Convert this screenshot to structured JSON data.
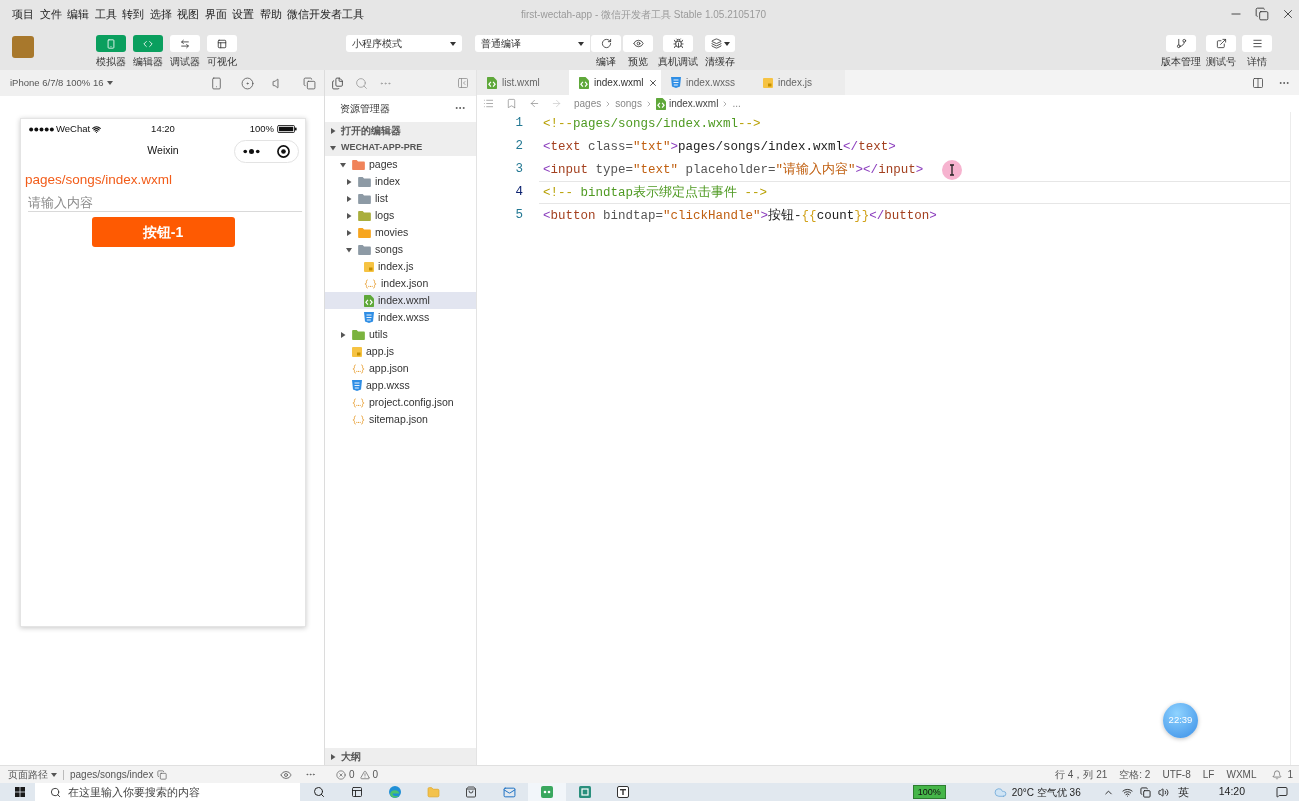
{
  "window": {
    "title": "first-wectah-app - 微信开发者工具 Stable 1.05.2105170"
  },
  "menu": [
    "项目",
    "文件",
    "编辑",
    "工具",
    "转到",
    "选择",
    "视图",
    "界面",
    "设置",
    "帮助",
    "微信开发者工具"
  ],
  "toolbar": {
    "view_toggles": [
      {
        "label": "模拟器",
        "kind": "simulator",
        "on": true
      },
      {
        "label": "编辑器",
        "kind": "editor",
        "on": true
      },
      {
        "label": "调试器",
        "kind": "debugger",
        "on": false
      },
      {
        "label": "可视化",
        "kind": "visual",
        "on": false
      }
    ],
    "mode_select": {
      "value": "小程序模式"
    },
    "compile_select": {
      "value": "普通编译"
    },
    "actions": [
      {
        "label": "编译",
        "kind": "compile"
      },
      {
        "label": "预览",
        "kind": "preview"
      },
      {
        "label": "真机调试",
        "kind": "remote_debug"
      },
      {
        "label": "清缓存",
        "kind": "clear_cache"
      }
    ],
    "right_actions": [
      {
        "label": "版本管理",
        "kind": "version"
      },
      {
        "label": "测试号",
        "kind": "test_account"
      },
      {
        "label": "详情",
        "kind": "details"
      }
    ]
  },
  "simulator": {
    "device": "iPhone 6/7/8 100% 16",
    "status_bar": {
      "carrier": "WeChat",
      "time": "14:20",
      "battery": "100%"
    },
    "nav_title": "Weixin",
    "page_text": "pages/songs/index.wxml",
    "input": {
      "placeholder": "请输入内容"
    },
    "button": "按钮-1"
  },
  "explorer": {
    "title": "资源管理器",
    "open_editors": {
      "label": "打开的编辑器",
      "expanded": false
    },
    "project": {
      "label": "WECHAT-APP-PRE",
      "expanded": true,
      "tree": [
        {
          "name": "pages",
          "kind": "folder",
          "color": "#f0835a",
          "expanded": true,
          "selected": false,
          "children": [
            {
              "name": "index",
              "kind": "folder",
              "color": "#8d9aa5",
              "expanded": false,
              "selected": false
            },
            {
              "name": "list",
              "kind": "folder",
              "color": "#8d9aa5",
              "expanded": false,
              "selected": false
            },
            {
              "name": "logs",
              "kind": "folder",
              "color": "#a9ae3c",
              "expanded": false,
              "selected": false
            },
            {
              "name": "movies",
              "kind": "folder",
              "color": "#f7a51e",
              "expanded": false,
              "selected": false
            },
            {
              "name": "songs",
              "kind": "folder",
              "color": "#8d9aa5",
              "expanded": true,
              "selected": false,
              "children": [
                {
                  "name": "index.js",
                  "kind": "js",
                  "selected": false
                },
                {
                  "name": "index.json",
                  "kind": "json",
                  "selected": false
                },
                {
                  "name": "index.wxml",
                  "kind": "wxml",
                  "selected": true
                },
                {
                  "name": "index.wxss",
                  "kind": "wxss",
                  "selected": false
                }
              ]
            }
          ]
        },
        {
          "name": "utils",
          "kind": "folder",
          "color": "#7bb33f",
          "expanded": false,
          "selected": false
        },
        {
          "name": "app.js",
          "kind": "js",
          "selected": false
        },
        {
          "name": "app.json",
          "kind": "json",
          "selected": false
        },
        {
          "name": "app.wxss",
          "kind": "wxss",
          "selected": false
        },
        {
          "name": "project.config.json",
          "kind": "json",
          "selected": false
        },
        {
          "name": "sitemap.json",
          "kind": "json",
          "selected": false
        }
      ]
    },
    "outline": {
      "label": "大纲",
      "expanded": false
    }
  },
  "editor": {
    "tabs": [
      {
        "label": "list.wxml",
        "kind": "wxml",
        "selected": false
      },
      {
        "label": "index.wxml",
        "kind": "wxml",
        "selected": true
      },
      {
        "label": "index.wxss",
        "kind": "wxss",
        "selected": false
      },
      {
        "label": "index.js",
        "kind": "js",
        "selected": false
      }
    ],
    "breadcrumb": [
      {
        "label": "pages",
        "kind": "folder"
      },
      {
        "label": "songs",
        "kind": "folder"
      },
      {
        "label": "index.wxml",
        "kind": "wxml"
      },
      {
        "label": "...",
        "kind": "more"
      }
    ],
    "lines": [
      {
        "number": "1",
        "current": false,
        "tokens": [
          {
            "kind": "comment_mark",
            "text": "<!--"
          },
          {
            "kind": "comment",
            "text": "pages/songs/index.wxml"
          },
          {
            "kind": "comment_mark",
            "text": "-->"
          }
        ]
      },
      {
        "number": "2",
        "current": false,
        "tokens": [
          {
            "kind": "bracket",
            "text": "<"
          },
          {
            "kind": "tag",
            "text": "text"
          },
          {
            "kind": "attr",
            "text": " class="
          },
          {
            "kind": "string",
            "text": "\"txt\""
          },
          {
            "kind": "bracket",
            "text": ">"
          },
          {
            "kind": "text",
            "text": "pages/songs/index.wxml"
          },
          {
            "kind": "bracket",
            "text": "</"
          },
          {
            "kind": "tag",
            "text": "text"
          },
          {
            "kind": "bracket",
            "text": ">"
          }
        ]
      },
      {
        "number": "3",
        "current": false,
        "tokens": [
          {
            "kind": "bracket",
            "text": "<"
          },
          {
            "kind": "tag",
            "text": "input"
          },
          {
            "kind": "attr",
            "text": " type="
          },
          {
            "kind": "string",
            "text": "\"text\""
          },
          {
            "kind": "attr",
            "text": " placeholder="
          },
          {
            "kind": "string",
            "text": "\"请输入内容\""
          },
          {
            "kind": "bracket",
            "text": "></"
          },
          {
            "kind": "tag",
            "text": "input"
          },
          {
            "kind": "bracket",
            "text": ">"
          }
        ]
      },
      {
        "number": "4",
        "current": true,
        "tokens": [
          {
            "kind": "comment_mark",
            "text": "<!--"
          },
          {
            "kind": "comment",
            "text": " bindtap表示绑定点击事件 "
          },
          {
            "kind": "comment_mark",
            "text": "-->"
          }
        ]
      },
      {
        "number": "5",
        "current": false,
        "tokens": [
          {
            "kind": "bracket",
            "text": "<"
          },
          {
            "kind": "tag",
            "text": "button"
          },
          {
            "kind": "attr",
            "text": " bindtap="
          },
          {
            "kind": "string",
            "text": "\"clickHandle\""
          },
          {
            "kind": "bracket",
            "text": ">"
          },
          {
            "kind": "text",
            "text": "按钮-"
          },
          {
            "kind": "brace",
            "text": "{{"
          },
          {
            "kind": "text",
            "text": "count"
          },
          {
            "kind": "brace",
            "text": "}}"
          },
          {
            "kind": "bracket",
            "text": "</"
          },
          {
            "kind": "tag",
            "text": "button"
          },
          {
            "kind": "bracket",
            "text": ">"
          }
        ]
      }
    ],
    "floating_timer": "22:39"
  },
  "status_bar": {
    "page_path_label": "页面路径",
    "page_path": "pages/songs/index",
    "errors": "0",
    "warnings": "0",
    "position": "行 4，列 21",
    "indent": "空格: 2",
    "encoding": "UTF-8",
    "eol": "LF",
    "language": "WXML",
    "notifications": "1"
  },
  "taskbar": {
    "search": {
      "placeholder": "在这里输入你要搜索的内容"
    },
    "battery": "100%",
    "weather": "20°C 空气优 36",
    "input_method": "英",
    "time": "14:20"
  }
}
